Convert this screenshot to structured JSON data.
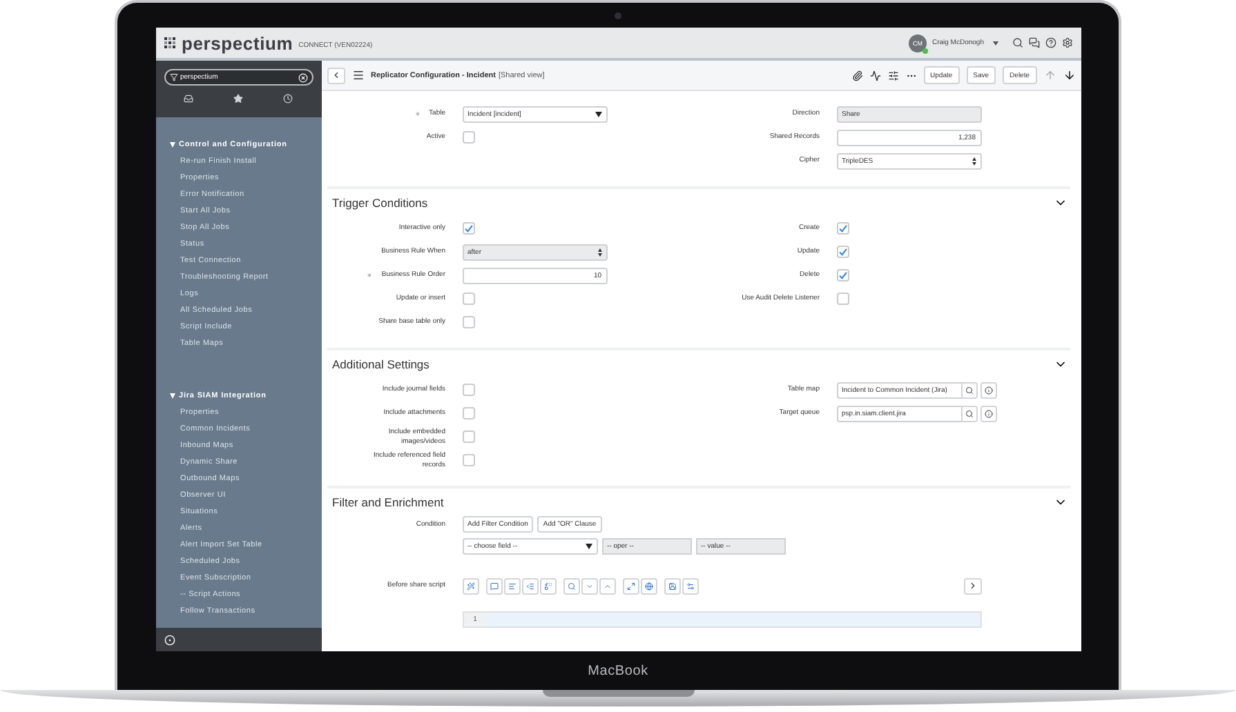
{
  "device": {
    "label": "MacBook"
  },
  "header": {
    "logo": "perspectium",
    "instance": "CONNECT (VEN02224)",
    "user": {
      "initials": "CM",
      "name": "Craig McDonogh",
      "online": true
    }
  },
  "sidebar": {
    "filter": {
      "value": "perspectium"
    },
    "groups": [
      {
        "title": "Control and Configuration",
        "expanded": true,
        "items": [
          "Re-run Finish Install",
          "Properties",
          "Error Notification",
          "Start All Jobs",
          "Stop All Jobs",
          "Status",
          "Test Connection",
          "Troubleshooting Report",
          "Logs",
          "All Scheduled Jobs",
          "Script Include",
          "Table Maps"
        ]
      },
      {
        "title": "Jira SIAM Integration",
        "expanded": true,
        "items": [
          "Properties",
          "Common Incidents",
          "Inbound Maps",
          "Dynamic Share",
          "Outbound Maps",
          "Observer UI",
          "Situations",
          "Alerts",
          "Alert Import Set Table",
          "Scheduled Jobs",
          "Event Subscription",
          "-- Script Actions",
          "Follow Transactions"
        ]
      }
    ]
  },
  "form_header": {
    "title": "Replicator Configuration - Incident",
    "view": "[Shared view]",
    "buttons": [
      "Update",
      "Save",
      "Delete"
    ]
  },
  "sections": [
    {
      "kind": "fields",
      "left": [
        {
          "label": "Table",
          "kind": "select",
          "value": "Incident [incident]",
          "required": true
        },
        {
          "label": "Active",
          "kind": "checkbox",
          "checked": false,
          "required": false
        }
      ],
      "right": [
        {
          "label": "Direction",
          "kind": "text",
          "value": "Share",
          "readonly": true,
          "required": false
        },
        {
          "label": "Shared Records",
          "kind": "number",
          "value": "1,238",
          "readonly": false,
          "required": false
        },
        {
          "label": "Cipher",
          "kind": "choice",
          "value": "TripleDES",
          "readonly": false,
          "required": false
        }
      ]
    },
    {
      "kind": "fields",
      "title": "Trigger Conditions",
      "expanded": true,
      "left": [
        {
          "label": "Interactive only",
          "kind": "checkbox",
          "checked": true,
          "required": false
        },
        {
          "label": "Business Rule When",
          "kind": "choice",
          "value": "after",
          "readonly": true,
          "required": false
        },
        {
          "label": "Business Rule Order",
          "kind": "number",
          "value": "10",
          "readonly": false,
          "required": true
        },
        {
          "label": "Update or insert",
          "kind": "checkbox",
          "checked": false,
          "required": false
        },
        {
          "label": "Share base table only",
          "kind": "checkbox",
          "checked": false,
          "required": false
        }
      ],
      "right": [
        {
          "label": "Create",
          "kind": "checkbox",
          "checked": true,
          "required": false
        },
        {
          "label": "Update",
          "kind": "checkbox",
          "checked": true,
          "required": false
        },
        {
          "label": "Delete",
          "kind": "checkbox",
          "checked": true,
          "required": false
        },
        {
          "label": "Use Audit Delete Listener",
          "kind": "checkbox",
          "checked": false,
          "required": false
        }
      ]
    },
    {
      "kind": "fields",
      "title": "Additional Settings",
      "expanded": true,
      "left": [
        {
          "label": "Include journal fields",
          "kind": "checkbox",
          "checked": false,
          "required": false
        },
        {
          "label": "Include attachments",
          "kind": "checkbox",
          "checked": false,
          "required": false
        },
        {
          "label": "Include embedded images/videos",
          "kind": "checkbox",
          "checked": false,
          "required": false
        },
        {
          "label": "Include referenced field records",
          "kind": "checkbox",
          "checked": false,
          "required": false
        }
      ],
      "right": [
        {
          "label": "Table map",
          "kind": "lookup",
          "value": "Incident to Common Incident (Jira)",
          "readonly": false,
          "required": false
        },
        {
          "label": "Target queue",
          "kind": "lookup",
          "value": "psp.in.siam.client.jira",
          "readonly": false,
          "required": false
        }
      ]
    },
    {
      "kind": "filter",
      "title": "Filter and Enrichment",
      "expanded": true,
      "condition": {
        "label": "Condition",
        "buttons": [
          "Add Filter Condition",
          "Add \"OR\" Clause"
        ],
        "field": "-- choose field --",
        "oper": "-- oper --",
        "value": "-- value --"
      },
      "script": {
        "label": "Before share script",
        "line": "1"
      }
    }
  ]
}
